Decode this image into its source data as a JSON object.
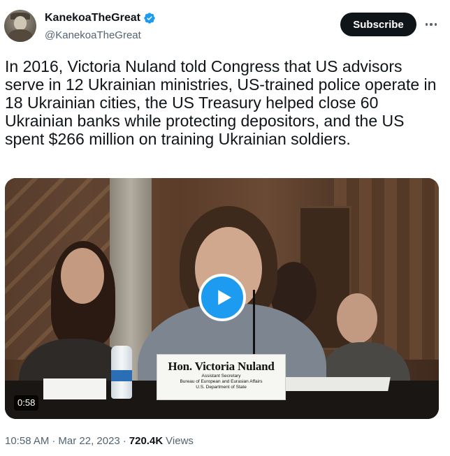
{
  "author": {
    "display_name": "KanekoaTheGreat",
    "handle": "@KanekoaTheGreat",
    "verified": true,
    "verified_color": "#1d9bf0"
  },
  "actions": {
    "subscribe_label": "Subscribe",
    "more_icon": "more-horizontal-icon"
  },
  "tweet": {
    "text": "In 2016, Victoria Nuland told Congress that US advisors serve in 12 Ukrainian ministries, US-trained police operate in 18 Ukrainian cities, the US Treasury helped close 60 Ukrainian banks while protecting depositors, and the US spent $266 million on training Ukrainian soldiers."
  },
  "media": {
    "type": "video",
    "duration": "0:58",
    "play_icon": "play-icon",
    "nameplate": {
      "name": "Hon. Victoria Nuland",
      "line1": "Assistant Secretary",
      "line2": "Bureau of European and Eurasian Affairs",
      "line3": "U.S. Department of State"
    }
  },
  "meta": {
    "time": "10:58 AM",
    "separator": "·",
    "date": "Mar 22, 2023",
    "views_count": "720.4K",
    "views_label": "Views"
  },
  "colors": {
    "text_primary": "#0f1419",
    "text_secondary": "#536471",
    "accent": "#1d9bf0",
    "button_bg": "#0f1419"
  }
}
